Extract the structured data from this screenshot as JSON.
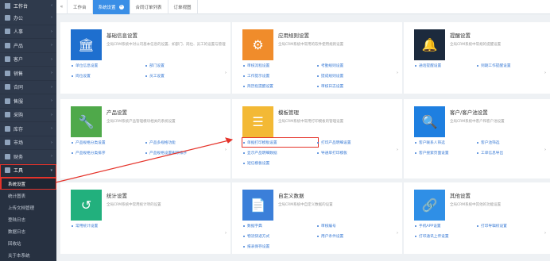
{
  "sidebar": {
    "top_label": "工作台",
    "items": [
      {
        "label": "办公",
        "expanded": false
      },
      {
        "label": "人事",
        "expanded": false
      },
      {
        "label": "产品",
        "expanded": false
      },
      {
        "label": "客户",
        "expanded": false
      },
      {
        "label": "销售",
        "expanded": false
      },
      {
        "label": "合同",
        "expanded": false
      },
      {
        "label": "售服",
        "expanded": false
      },
      {
        "label": "采购",
        "expanded": false
      },
      {
        "label": "库存",
        "expanded": false
      },
      {
        "label": "市场",
        "expanded": false
      },
      {
        "label": "财务",
        "expanded": false
      },
      {
        "label": "工具",
        "expanded": true
      }
    ],
    "subitems": [
      {
        "label": "系统设置",
        "current": true
      },
      {
        "label": "统计图表",
        "current": false
      },
      {
        "label": "上传文档管理",
        "current": false
      },
      {
        "label": "登陆日志",
        "current": false
      },
      {
        "label": "数据日志",
        "current": false
      },
      {
        "label": "回收站",
        "current": false
      },
      {
        "label": "关于本系统",
        "current": false
      }
    ]
  },
  "topbar": {
    "tabs": [
      {
        "label": "工作台",
        "active": false
      },
      {
        "label": "系统设置",
        "active": true
      },
      {
        "label": "合同订单列表",
        "active": false
      },
      {
        "label": "订单视图",
        "active": false
      }
    ]
  },
  "cards": [
    {
      "title": "基础信息设置",
      "desc": "全局CRM系统中对公司基本信息的设置、如部门、岗位、员工的设置与管理",
      "icon": "bank-icon",
      "color": "#1e6fcf",
      "links": [
        "单位信息设置",
        "部门设置",
        "岗位设置",
        "员工设置"
      ]
    },
    {
      "title": "应用规则设置",
      "desc": "全局CRM系统中常用的软件使用规则设置",
      "icon": "gear-icon",
      "color": "#f08c2b",
      "links": [
        "审核流程设置",
        "考勤规则设置",
        "工作提示设置",
        "提成规则设置",
        "简历指提醒设置",
        "审核日志设置"
      ]
    },
    {
      "title": "提醒设置",
      "desc": "全局CRM系统中常规的提醒设置",
      "icon": "bell-icon",
      "color": "#1c2a3d",
      "links": [
        "通话提醒设置",
        "到期工作提醒设置"
      ]
    },
    {
      "title": "产品设置",
      "desc": "全局CRM系统产品管理模块相关的系统设置",
      "icon": "wrench-icon",
      "color": "#4fa94a",
      "links": [
        "产品规格分类设置",
        "产品多规格功能",
        "产品规格分类排序",
        "产品规格设置删除排序"
      ]
    },
    {
      "title": "模板管理",
      "desc": "全局CRM系统中常用打印模板的管理设置",
      "icon": "list-icon",
      "color": "#f3b935",
      "links": [
        "单据打印模板设置",
        "打印产品明细设置",
        "显示产品明细数据",
        "导通单打印模板",
        "短信模板设置",
        ""
      ]
    },
    {
      "title": "客户/客户池设置",
      "desc": "全局CRM系统中客户和客户池设置",
      "icon": "search-icon",
      "color": "#1e7fe0",
      "links": [
        "客户联系人筛选",
        "客户池筛选",
        "客户搜索页面设置",
        "工单信息导出"
      ]
    },
    {
      "title": "统计设置",
      "desc": "全局CRM系统中常用统计项的设置",
      "icon": "history-icon",
      "color": "#22b07d",
      "links": [
        "常用统计设置"
      ]
    },
    {
      "title": "自定义数据",
      "desc": "全局CRM系统中自定义数据的设置",
      "icon": "document-icon",
      "color": "#3b7fd9",
      "links": [
        "数据字典",
        "审核编号",
        "物流快递方式",
        "用户条件设置",
        "报表保存设置",
        ""
      ]
    },
    {
      "title": "其他设置",
      "desc": "全局CRM系统中其他的功能设置",
      "icon": "link-icon",
      "color": "#2f8fe6",
      "links": [
        "手机APP设置",
        "打印导辑权设置",
        "打印通讯上传设置",
        ""
      ]
    }
  ]
}
